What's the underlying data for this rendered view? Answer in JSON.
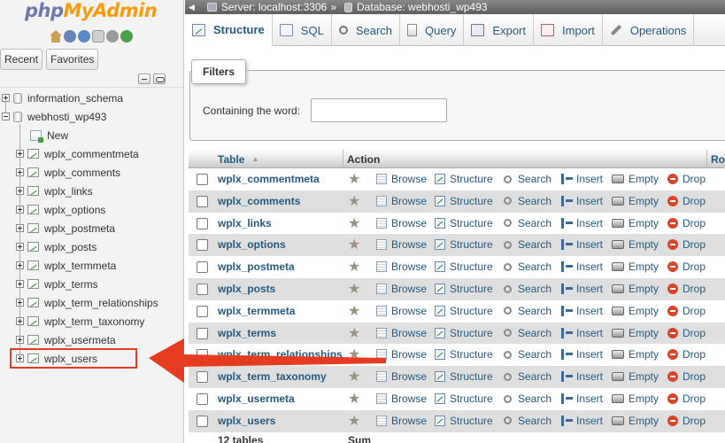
{
  "logo": {
    "part1": "php",
    "part2": "MyAdmin"
  },
  "nav": {
    "tabs": [
      "Recent",
      "Favorites"
    ],
    "databases": [
      {
        "name": "information_schema"
      },
      {
        "name": "webhosti_wp493"
      }
    ],
    "new_label": "New",
    "tables": [
      "wplx_commentmeta",
      "wplx_comments",
      "wplx_links",
      "wplx_options",
      "wplx_postmeta",
      "wplx_posts",
      "wplx_termmeta",
      "wplx_terms",
      "wplx_term_relationships",
      "wplx_term_taxonomy",
      "wplx_usermeta",
      "wplx_users"
    ],
    "highlighted_table": "wplx_users"
  },
  "breadcrumb": {
    "server": "Server: localhost:3306",
    "separator": "»",
    "database": "Database: webhosti_wp493"
  },
  "menu": {
    "tabs": [
      "Structure",
      "SQL",
      "Search",
      "Query",
      "Export",
      "Import",
      "Operations"
    ],
    "active": "Structure"
  },
  "filters": {
    "legend": "Filters",
    "label": "Containing the word:",
    "value": ""
  },
  "table": {
    "headers": {
      "table": "Table",
      "action": "Action",
      "rows": "Ro"
    },
    "actions": [
      "Browse",
      "Structure",
      "Search",
      "Insert",
      "Empty",
      "Drop"
    ],
    "rows": [
      "wplx_commentmeta",
      "wplx_comments",
      "wplx_links",
      "wplx_options",
      "wplx_postmeta",
      "wplx_posts",
      "wplx_termmeta",
      "wplx_terms",
      "wplx_term_relationships",
      "wplx_term_taxonomy",
      "wplx_usermeta",
      "wplx_users"
    ],
    "footer": {
      "count": "12 tables",
      "sum": "Sum"
    }
  },
  "colors": {
    "link": "#235a81",
    "highlight_red": "#e53c21",
    "row_alt": "#dfdfdf"
  }
}
